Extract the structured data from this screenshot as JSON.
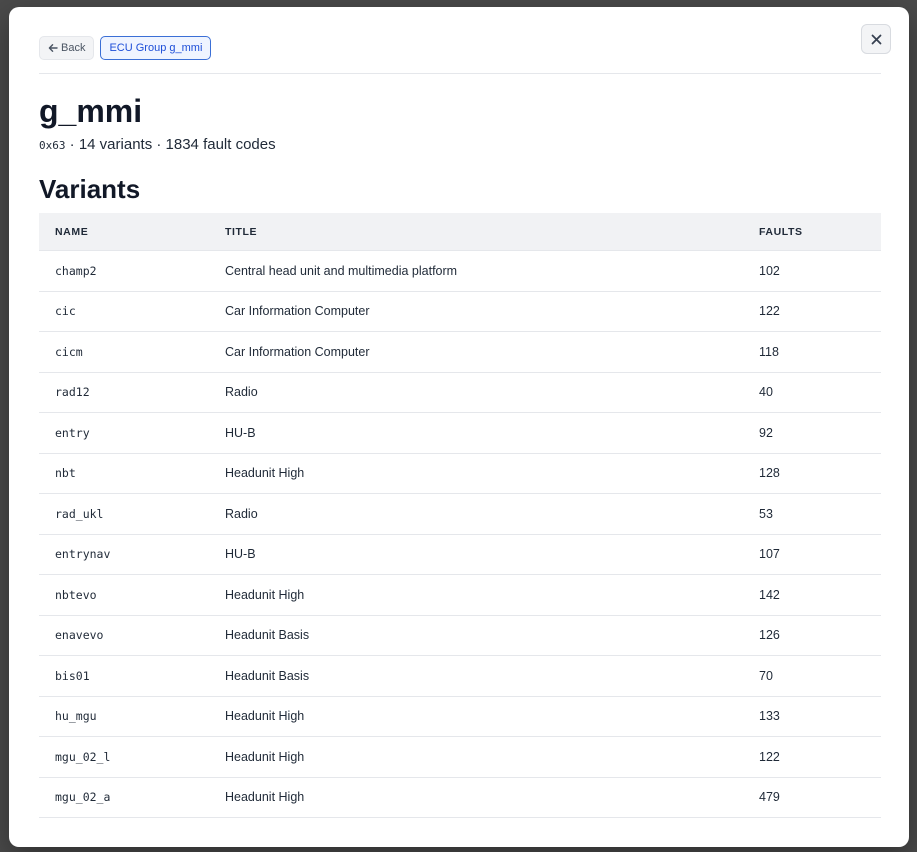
{
  "nav": {
    "back_label": "Back",
    "group_label": "ECU Group g_mmi"
  },
  "header": {
    "title": "g_mmi",
    "code": "0x63",
    "summary": " · 14 variants · 1834 fault codes"
  },
  "section": {
    "title": "Variants"
  },
  "table": {
    "columns": [
      "NAME",
      "TITLE",
      "FAULTS"
    ],
    "rows": [
      {
        "name": "champ2",
        "title": "Central head unit and multimedia platform",
        "faults": "102"
      },
      {
        "name": "cic",
        "title": "Car Information Computer",
        "faults": "122"
      },
      {
        "name": "cicm",
        "title": "Car Information Computer",
        "faults": "118"
      },
      {
        "name": "rad12",
        "title": "Radio",
        "faults": "40"
      },
      {
        "name": "entry",
        "title": "HU-B",
        "faults": "92"
      },
      {
        "name": "nbt",
        "title": "Headunit High",
        "faults": "128"
      },
      {
        "name": "rad_ukl",
        "title": "Radio",
        "faults": "53"
      },
      {
        "name": "entrynav",
        "title": "HU-B",
        "faults": "107"
      },
      {
        "name": "nbtevo",
        "title": "Headunit High",
        "faults": "142"
      },
      {
        "name": "enavevo",
        "title": "Headunit Basis",
        "faults": "126"
      },
      {
        "name": "bis01",
        "title": "Headunit Basis",
        "faults": "70"
      },
      {
        "name": "hu_mgu",
        "title": "Headunit High",
        "faults": "133"
      },
      {
        "name": "mgu_02_l",
        "title": "Headunit High",
        "faults": "122"
      },
      {
        "name": "mgu_02_a",
        "title": "Headunit High",
        "faults": "479"
      }
    ]
  },
  "icons": {
    "back": "arrow-left-icon",
    "close": "close-icon"
  },
  "colors": {
    "accent": "#1d4ed8",
    "header_bg": "#f1f2f4",
    "backdrop": "#4a4a4a"
  }
}
